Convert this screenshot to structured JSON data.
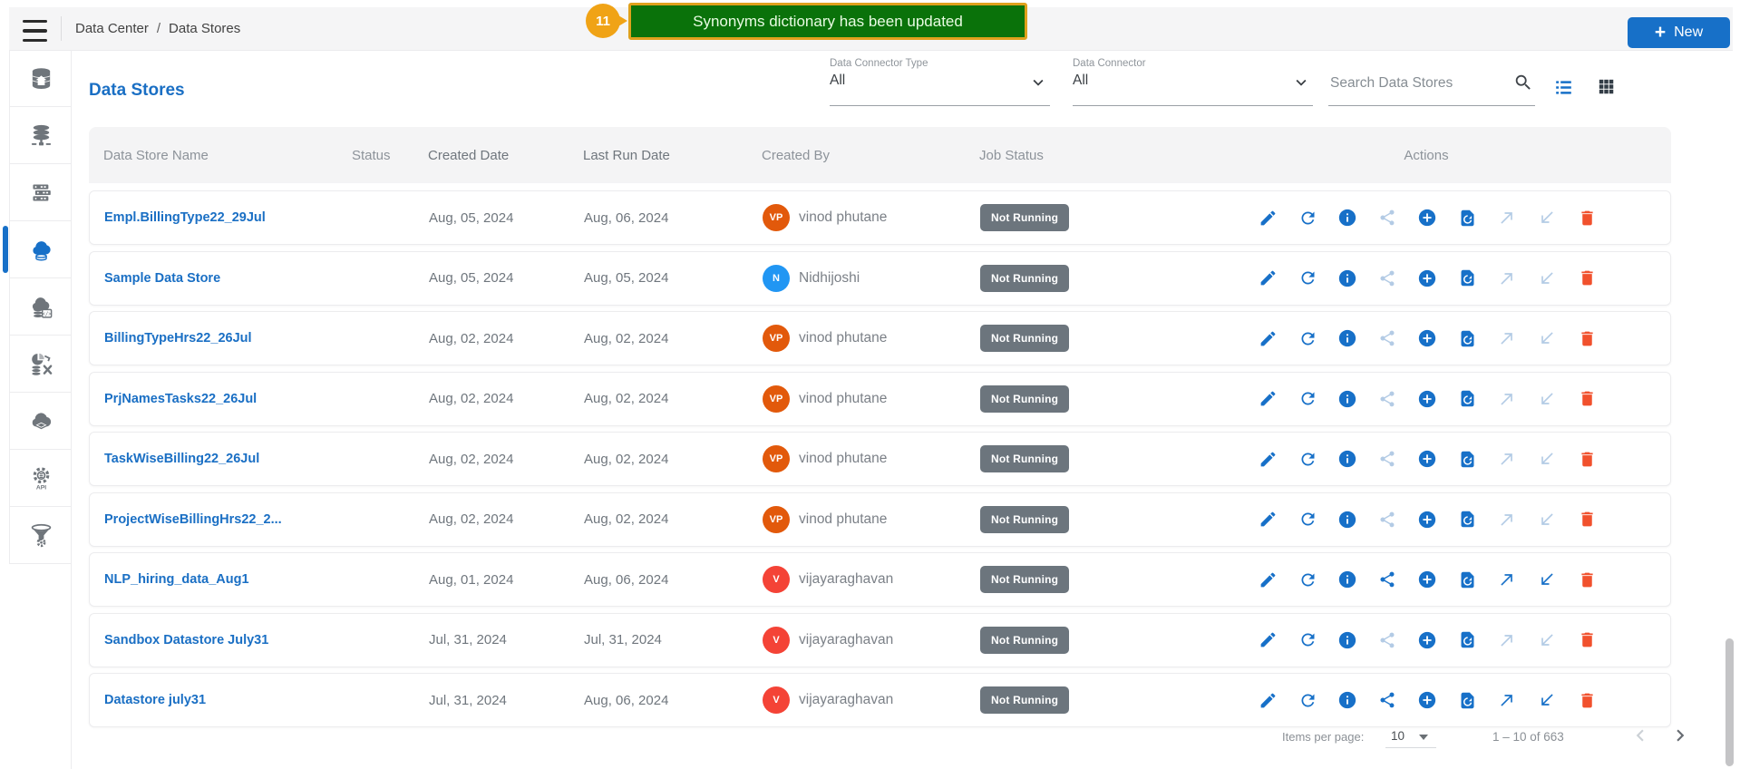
{
  "topbar": {
    "breadcrumb": {
      "section": "Data Center",
      "separator": "/",
      "page": "Data Stores"
    },
    "new_button": {
      "plus": "+",
      "label": "New"
    }
  },
  "toast": {
    "step_badge": "11",
    "message": "Synonyms dictionary has been updated"
  },
  "sidebar": {
    "items": [
      {
        "id": "data-center-home",
        "icon": "database-home-icon",
        "active": false
      },
      {
        "id": "databases",
        "icon": "database-network-icon",
        "active": false
      },
      {
        "id": "clusters",
        "icon": "server-rack-icon",
        "active": false
      },
      {
        "id": "data-stores",
        "icon": "cloud-database-icon",
        "active": true
      },
      {
        "id": "data-store-code",
        "icon": "cloud-database-code-icon",
        "active": false
      },
      {
        "id": "data-prep",
        "icon": "data-prep-icon",
        "active": false
      },
      {
        "id": "cloud-package",
        "icon": "cloud-package-icon",
        "active": false
      },
      {
        "id": "api",
        "icon": "api-gear-icon",
        "active": false
      },
      {
        "id": "data-filter",
        "icon": "funnel-gear-icon",
        "active": false
      }
    ]
  },
  "page": {
    "title": "Data Stores"
  },
  "filters": {
    "connector_type": {
      "label": "Data Connector Type",
      "value": "All"
    },
    "connector": {
      "label": "Data Connector",
      "value": "All"
    },
    "search_placeholder": "Search Data Stores"
  },
  "table": {
    "columns": [
      "Data Store Name",
      "Status",
      "Created Date",
      "Last Run Date",
      "Created By",
      "Job Status",
      "Actions"
    ],
    "action_icons": [
      {
        "id": "edit",
        "icon": "edit-icon"
      },
      {
        "id": "refresh",
        "icon": "refresh-icon"
      },
      {
        "id": "info",
        "icon": "info-icon"
      },
      {
        "id": "share",
        "icon": "share-icon"
      },
      {
        "id": "add",
        "icon": "add-circle-icon"
      },
      {
        "id": "restore",
        "icon": "restore-page-icon"
      },
      {
        "id": "export",
        "icon": "arrow-up-right-icon"
      },
      {
        "id": "import",
        "icon": "arrow-down-left-icon"
      },
      {
        "id": "delete",
        "icon": "delete-icon"
      }
    ],
    "rows": [
      {
        "name": "Empl.BillingType22_29Jul",
        "status": "",
        "created": "Aug, 05, 2024",
        "last_run": "Aug, 06, 2024",
        "creator": {
          "initials": "VP",
          "name": "vinod phutane",
          "color": "#e2590b"
        },
        "job_status": "Not Running",
        "disabled_actions": [
          "share",
          "export",
          "import"
        ]
      },
      {
        "name": "Sample Data Store",
        "status": "",
        "created": "Aug, 05, 2024",
        "last_run": "Aug, 05, 2024",
        "creator": {
          "initials": "N",
          "name": "Nidhijoshi",
          "color": "#2196f3"
        },
        "job_status": "Not Running",
        "disabled_actions": [
          "share",
          "export",
          "import"
        ]
      },
      {
        "name": "BillingTypeHrs22_26Jul",
        "status": "",
        "created": "Aug, 02, 2024",
        "last_run": "Aug, 02, 2024",
        "creator": {
          "initials": "VP",
          "name": "vinod phutane",
          "color": "#e2590b"
        },
        "job_status": "Not Running",
        "disabled_actions": [
          "share",
          "export",
          "import"
        ]
      },
      {
        "name": "PrjNamesTasks22_26Jul",
        "status": "",
        "created": "Aug, 02, 2024",
        "last_run": "Aug, 02, 2024",
        "creator": {
          "initials": "VP",
          "name": "vinod phutane",
          "color": "#e2590b"
        },
        "job_status": "Not Running",
        "disabled_actions": [
          "share",
          "export",
          "import"
        ]
      },
      {
        "name": "TaskWiseBilling22_26Jul",
        "status": "",
        "created": "Aug, 02, 2024",
        "last_run": "Aug, 02, 2024",
        "creator": {
          "initials": "VP",
          "name": "vinod phutane",
          "color": "#e2590b"
        },
        "job_status": "Not Running",
        "disabled_actions": [
          "share",
          "export",
          "import"
        ]
      },
      {
        "name": "ProjectWiseBillingHrs22_2...",
        "status": "",
        "created": "Aug, 02, 2024",
        "last_run": "Aug, 02, 2024",
        "creator": {
          "initials": "VP",
          "name": "vinod phutane",
          "color": "#e2590b"
        },
        "job_status": "Not Running",
        "disabled_actions": [
          "share",
          "export",
          "import"
        ]
      },
      {
        "name": "NLP_hiring_data_Aug1",
        "status": "",
        "created": "Aug, 01, 2024",
        "last_run": "Aug, 06, 2024",
        "creator": {
          "initials": "V",
          "name": "vijayaraghavan",
          "color": "#f44336"
        },
        "job_status": "Not Running",
        "disabled_actions": []
      },
      {
        "name": "Sandbox Datastore July31",
        "status": "",
        "created": "Jul, 31, 2024",
        "last_run": "Jul, 31, 2024",
        "creator": {
          "initials": "V",
          "name": "vijayaraghavan",
          "color": "#f44336"
        },
        "job_status": "Not Running",
        "disabled_actions": [
          "share",
          "export",
          "import"
        ]
      },
      {
        "name": "Datastore july31",
        "status": "",
        "created": "Jul, 31, 2024",
        "last_run": "Aug, 06, 2024",
        "creator": {
          "initials": "V",
          "name": "vijayaraghavan",
          "color": "#f44336"
        },
        "job_status": "Not Running",
        "disabled_actions": []
      }
    ]
  },
  "footer": {
    "items_per_page_label": "Items per page:",
    "items_per_page_value": "10",
    "range_label": "1 – 10 of 663"
  },
  "colors": {
    "accent": "#1770c8",
    "link_blue": "#1a6fc4",
    "toast_green": "#0a720a",
    "toast_border": "#dfa11d",
    "badge_orange": "#f0a316",
    "job_badge_grey": "#6c757d",
    "icon_disabled": "#b3cbe5",
    "delete_red": "#f1512d"
  }
}
